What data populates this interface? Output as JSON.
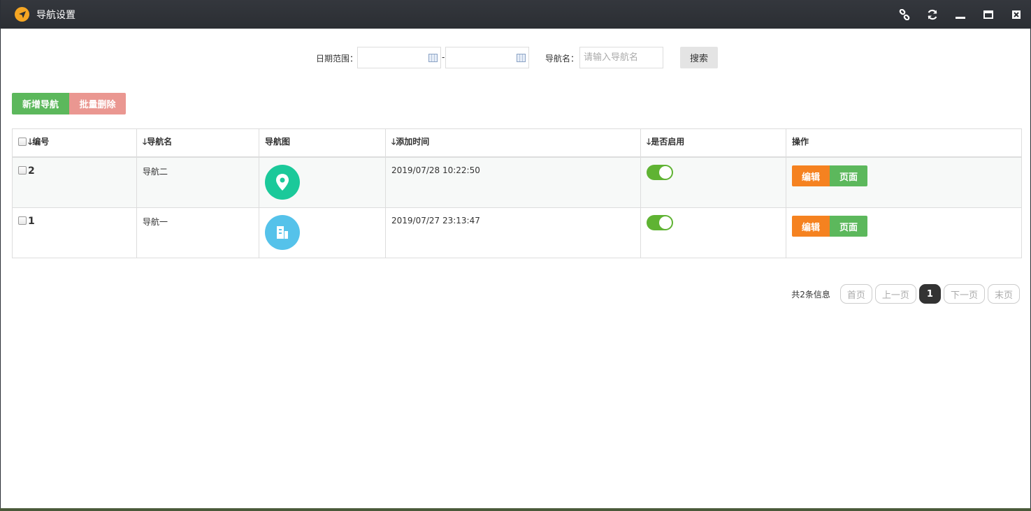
{
  "window": {
    "title": "导航设置",
    "title_icon": "navigation-arrow-icon",
    "controls": [
      "link-icon",
      "refresh-icon",
      "minimize-icon",
      "maximize-icon",
      "close-icon"
    ]
  },
  "search": {
    "date_label": "日期范围：",
    "date_separator": "-",
    "date_start_value": "",
    "date_end_value": "",
    "name_label": "导航名：",
    "name_placeholder": "请输入导航名",
    "name_value": "",
    "search_button": "搜索"
  },
  "toolbar": {
    "add_label": "新增导航",
    "batch_delete_label": "批量删除"
  },
  "table": {
    "columns": {
      "id": "编号",
      "name": "导航名",
      "image": "导航图",
      "time": "添加时间",
      "enabled": "是否启用",
      "ops": "操作"
    },
    "sort_arrow": "🡓",
    "rows": [
      {
        "id": "2",
        "name": "导航二",
        "icon": "location-pin-icon",
        "icon_color": "#1bc99a",
        "time": "2019/07/28 10:22:50",
        "enabled": true,
        "edit": "编辑",
        "page": "页面"
      },
      {
        "id": "1",
        "name": "导航一",
        "icon": "building-icon",
        "icon_color": "#55c2ea",
        "time": "2019/07/27 23:13:47",
        "enabled": true,
        "edit": "编辑",
        "page": "页面"
      }
    ]
  },
  "pager": {
    "total": "共2条信息",
    "first": "首页",
    "prev": "上一页",
    "current": "1",
    "next": "下一页",
    "last": "末页"
  },
  "colors": {
    "titlebar": "#2b2e33",
    "success": "#5cb85c",
    "danger_light": "#ea9791",
    "warning": "#f58220",
    "toggle_on": "#5fb333"
  }
}
